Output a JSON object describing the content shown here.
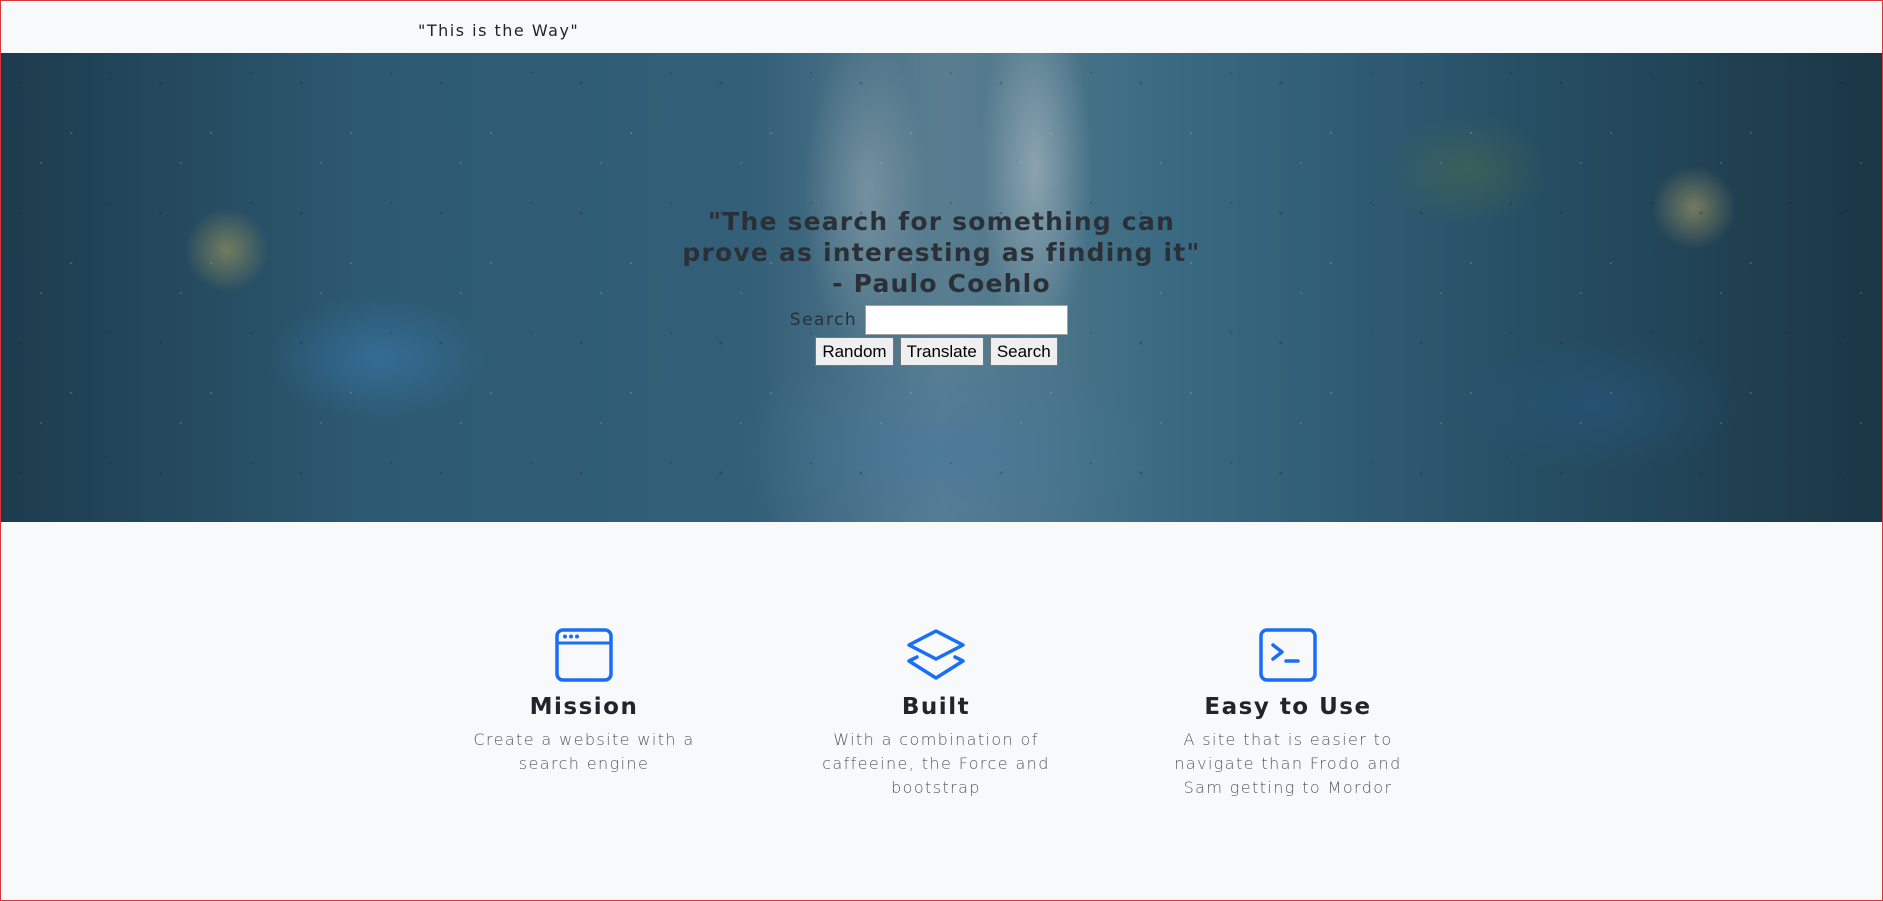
{
  "navbar": {
    "brand": "\"This is the Way\""
  },
  "hero": {
    "quote": "\"The search for something can prove as interesting as finding it\" - Paulo Coehlo",
    "search_label": "Search",
    "search_value": "",
    "buttons": {
      "random": "Random",
      "translate": "Translate",
      "search": "Search"
    }
  },
  "features": [
    {
      "icon": "browser-window-icon",
      "title": "Mission",
      "text": "Create a website with a search engine"
    },
    {
      "icon": "layers-icon",
      "title": "Built",
      "text": "With a combination of caffeeine, the Force and bootstrap"
    },
    {
      "icon": "terminal-icon",
      "title": "Easy to Use",
      "text": "A site that is easier to navigate than Frodo and Sam getting to Mordor"
    }
  ],
  "colors": {
    "accent": "#1a6ef5",
    "frame_border": "#d9363e",
    "background": "#f8f9fa"
  }
}
